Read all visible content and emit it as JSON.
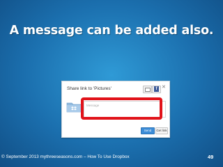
{
  "slide": {
    "title": "A message can be added also.",
    "footer": "© September 2013 mythreeseasons.com – How To Use Dropbox",
    "page_number": "49"
  },
  "dialog": {
    "title": "Share link to 'Pictures'",
    "message_placeholder": "Message",
    "send_label": "Send",
    "get_link_label": "Get link",
    "close_glyph": "✕"
  },
  "icons": {
    "email": "mail-icon",
    "facebook": "facebook-icon",
    "close": "close-icon",
    "folder": "dropbox-folder-icon"
  },
  "colors": {
    "slide_background": "#1b6fae",
    "highlight": "#e1131a",
    "send_button": "#3c8dd8",
    "folder": "#8fb9dd"
  }
}
